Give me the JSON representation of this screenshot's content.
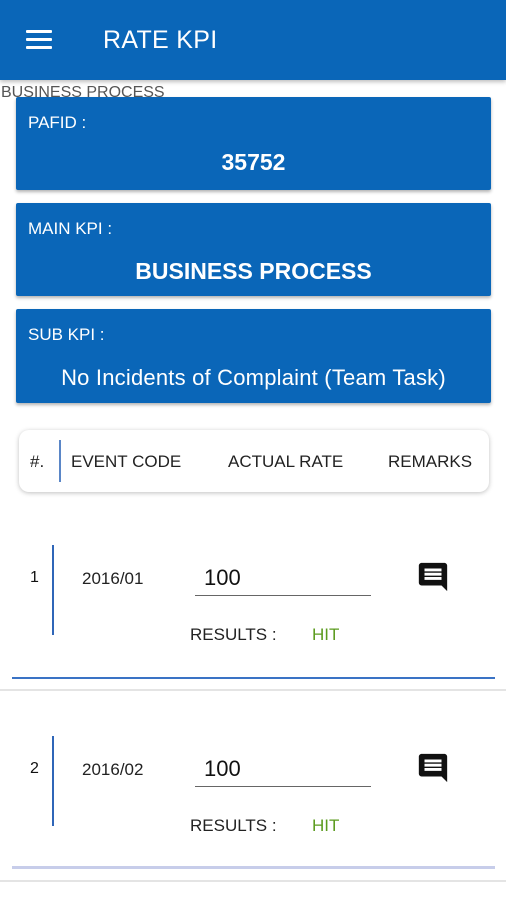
{
  "app": {
    "title": "RATE KPI",
    "ghost_label": "BUSINESS PROCESS"
  },
  "cards": {
    "pafid": {
      "label": "PAFID :",
      "value": "35752"
    },
    "main_kpi": {
      "label": "MAIN KPI :",
      "value": "BUSINESS PROCESS"
    },
    "sub_kpi": {
      "label": "SUB KPI :",
      "value": "No Incidents of Complaint (Team Task)"
    }
  },
  "table": {
    "headers": {
      "num": "#.",
      "event_code": "EVENT CODE",
      "actual_rate": "ACTUAL RATE",
      "remarks": "REMARKS"
    },
    "rows": [
      {
        "num": "1",
        "event_code": "2016/01",
        "rate": "100",
        "results_label": "RESULTS :",
        "results_value": "HIT"
      },
      {
        "num": "2",
        "event_code": "2016/02",
        "rate": "100",
        "results_label": "RESULTS :",
        "results_value": "HIT"
      }
    ]
  },
  "icons": {
    "menu": "menu-icon",
    "remark": "comment-icon"
  },
  "colors": {
    "primary": "#0a66b8",
    "hit": "#5b9b1e"
  }
}
